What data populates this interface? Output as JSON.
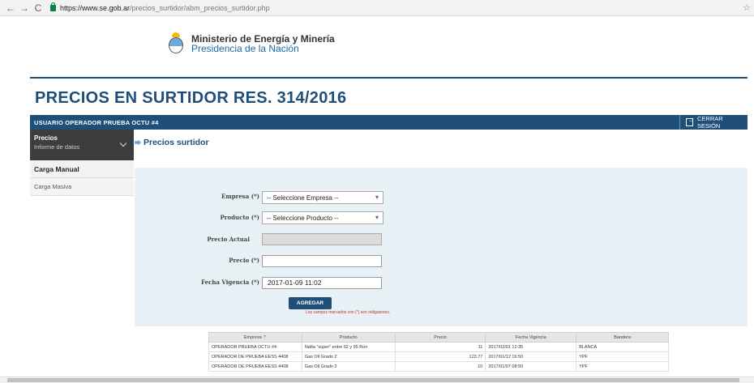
{
  "browser": {
    "url_host": "https://www.se.gob.ar",
    "url_path": "/precios_surtidor/abm_precios_surtidor.php",
    "back": "←",
    "forward": "→",
    "reload": "C",
    "star": "☆"
  },
  "header": {
    "ministry_name": "Ministerio de Energía y Minería",
    "ministry_sub": "Presidencia de la Nación",
    "page_title": "PRECIOS EN SURTIDOR RES. 314/2016"
  },
  "userbar": {
    "label": "USUARIO  OPERADOR PRUEBA OCTU #4",
    "logout": "CERRAR SESIÓN"
  },
  "sidebar": {
    "head_title": "Precios",
    "head_sub": "Informe de datos",
    "items": [
      {
        "label": "Carga Manual"
      },
      {
        "label": "Carga Masiva"
      }
    ]
  },
  "section": {
    "title": "Precios surtidor"
  },
  "form": {
    "empresa_label": "Empresa (*)",
    "empresa_value": "-- Seleccione Empresa --",
    "producto_label": "Producto (*)",
    "producto_value": "-- Seleccione Producto --",
    "precio_actual_label": "Precio Actual",
    "precio_actual_value": "",
    "precio_label": "Precio (*)",
    "precio_value": "",
    "fecha_label": "Fecha Vigencia (*)",
    "fecha_value": "2017-01-09 11:02",
    "add_button": "AGREGAR",
    "required_note": "Los campos marcados con (*) son obligatorios."
  },
  "table": {
    "headers": [
      "Empresa",
      "Producto",
      "Precio",
      "Fecha Vigencia",
      "Bandera"
    ],
    "sort_indicator": "⇡",
    "rows": [
      [
        "OPERADOR PRUEBA OCTU #4",
        "Nafta \"súper\" entre 92 y 95 Ron",
        "11",
        "2017/02/01 12:35",
        "BLANCA"
      ],
      [
        "OPERADOR DE PRUEBA EESS 4408",
        "Gas Oil Grado 2",
        "123.77",
        "2017/01/12 16:50",
        "YPF"
      ],
      [
        "OPERADOR DE PRUEBA EESS 4408",
        "Gas Oil Grado 2",
        "10",
        "2017/01/07 08:50",
        "YPF"
      ]
    ]
  }
}
